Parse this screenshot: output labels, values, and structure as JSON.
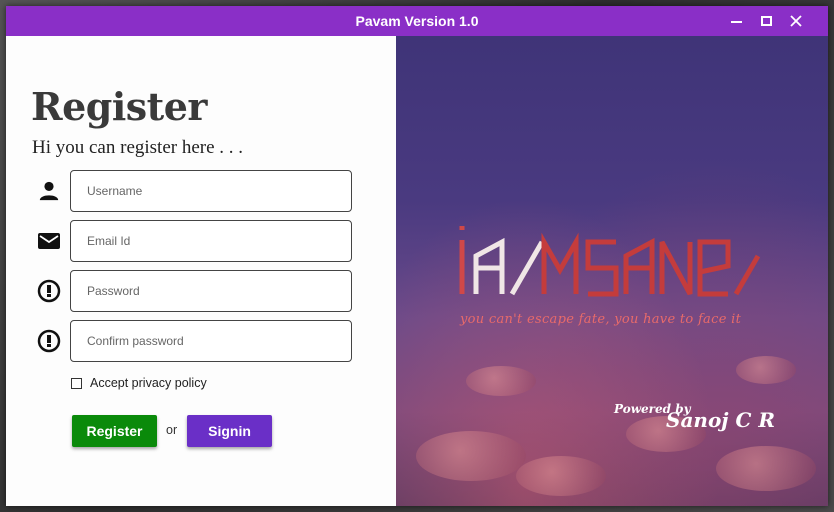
{
  "window": {
    "title": "Pavam Version 1.0",
    "accent_color": "#8a2fc7"
  },
  "form": {
    "heading": "Register",
    "subheading": "Hi you can register here . . .",
    "fields": [
      {
        "icon": "person-icon",
        "placeholder": "Username",
        "value": ""
      },
      {
        "icon": "mail-icon",
        "placeholder": "Email Id",
        "value": ""
      },
      {
        "icon": "password-icon",
        "placeholder": "Password",
        "value": ""
      },
      {
        "icon": "password-icon",
        "placeholder": "Confirm password",
        "value": ""
      }
    ],
    "privacy_label": "Accept privacy policy",
    "privacy_checked": false,
    "register_label": "Register",
    "or_label": "or",
    "signin_label": "Signin",
    "register_color": "#0a8a0a",
    "signin_color": "#6a2fc7"
  },
  "brand": {
    "logo_text": "iamsane",
    "tagline": "you can't escape fate, you have to face it",
    "powered_by": "Powered by",
    "author": "Sanoj C R"
  }
}
